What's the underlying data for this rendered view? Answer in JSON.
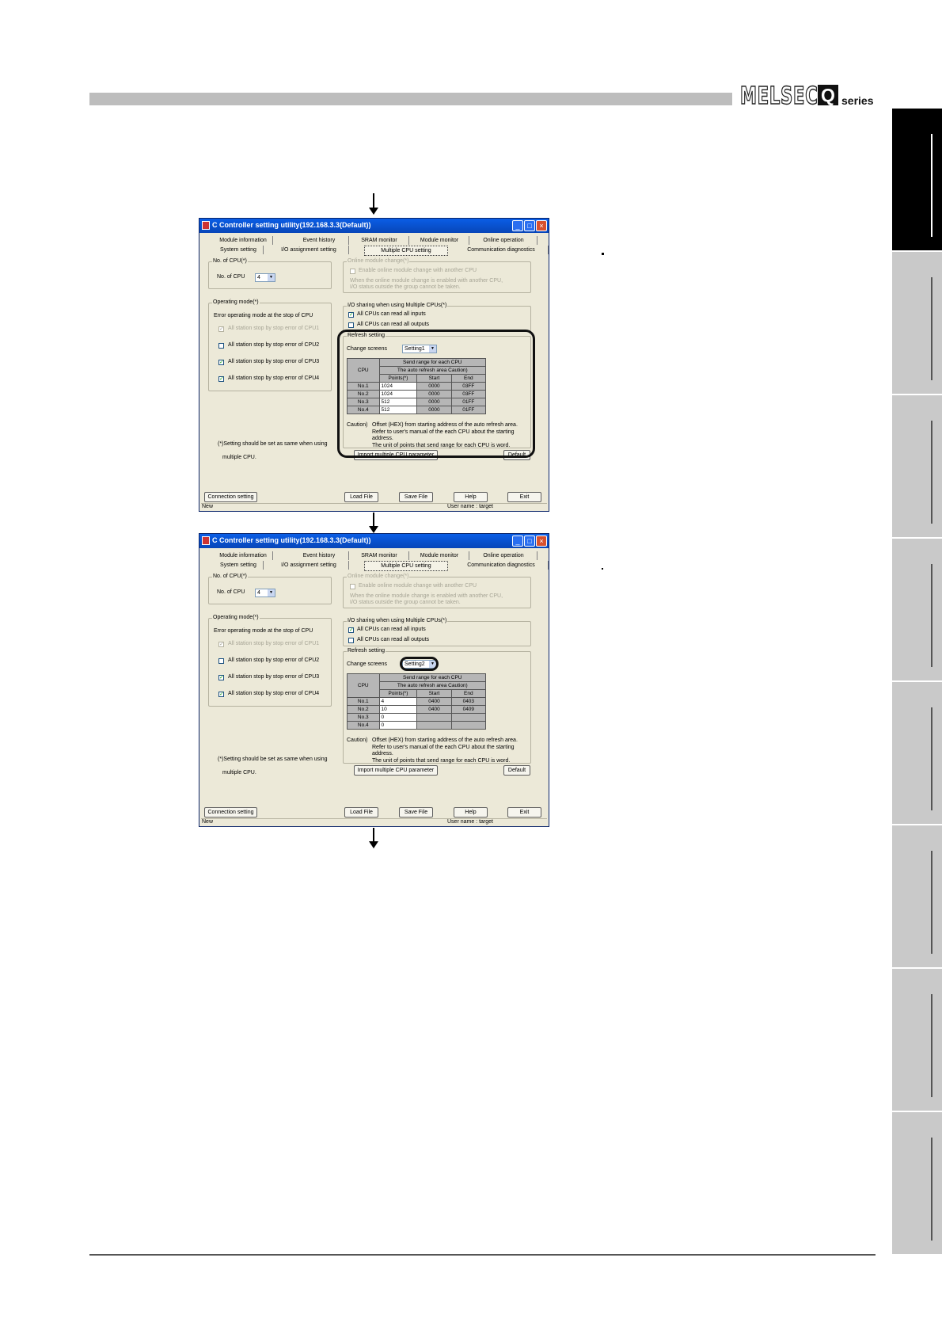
{
  "header": {
    "logo_brand": "MELSEC",
    "logo_q": "Q",
    "logo_series": "series"
  },
  "window_common": {
    "title": "C Controller setting utility(192.168.3.3(Default))",
    "tabs_row1": [
      "Module information",
      "Event history",
      "SRAM monitor",
      "Module monitor",
      "Online operation"
    ],
    "tabs_row2": [
      "System setting",
      "I/O assignment setting",
      "Multiple CPU setting",
      "Communication diagnostics"
    ],
    "no_cpu_group": "No. of CPU(*)",
    "no_cpu_label": "No. of CPU",
    "online_change_group": "Online module change(*)",
    "online_change_check": "Enable online module change with another CPU",
    "online_change_note1": "When the online module change is enabled with another CPU,",
    "online_change_note2": "I/O status outside the group cannot be taken.",
    "op_mode_group": "Operating mode(*)",
    "op_mode_subtitle": "Error operating mode at the stop of CPU",
    "op_mode_items": [
      "All station stop by stop error of CPU1",
      "All station stop by stop error of CPU2",
      "All station stop by stop error of CPU3",
      "All station stop by stop error of CPU4"
    ],
    "op_mode_checked": [
      true,
      false,
      true,
      true
    ],
    "io_group": "I/O sharing when using Multiple CPUs(*)",
    "io_items": [
      "All CPUs can read all inputs",
      "All CPUs can read all outputs"
    ],
    "io_checked": [
      true,
      false
    ],
    "refresh_group": "Refresh setting",
    "change_screens_label": "Change screens",
    "table_head_send": "Send range for each CPU",
    "table_head_auto": "The auto refresh area Caution)",
    "table_head_cpu": "CPU",
    "table_head_points": "Points(*)",
    "table_head_start": "Start",
    "table_head_end": "End",
    "caution_label": "Caution)",
    "caution_lines": [
      "Offset (HEX) from starting address of the auto refresh area.",
      "Refer to user's manual of the each CPU about the starting",
      "address.",
      "The unit of points that send range for each CPU is word."
    ],
    "note_line1": "(*)Setting should be set as same when using",
    "note_line2": "multiple CPU.",
    "import_button": "Import multiple CPU parameter",
    "default_button": "Default",
    "connection_button": "Connection setting",
    "load_button": "Load File",
    "save_button": "Save File",
    "help_button": "Help",
    "exit_button": "Exit",
    "status_left": "New",
    "status_right": "User name : target"
  },
  "window1": {
    "no_cpu_value": "4",
    "change_screens_value": "Setting1",
    "rows": [
      {
        "cpu": "No.1",
        "points": "1024",
        "start": "0000",
        "end": "03FF"
      },
      {
        "cpu": "No.2",
        "points": "1024",
        "start": "0000",
        "end": "03FF"
      },
      {
        "cpu": "No.3",
        "points": "512",
        "start": "0000",
        "end": "01FF"
      },
      {
        "cpu": "No.4",
        "points": "512",
        "start": "0000",
        "end": "01FF"
      }
    ]
  },
  "window2": {
    "no_cpu_value": "4",
    "change_screens_value": "Setting2",
    "rows": [
      {
        "cpu": "No.1",
        "points": "4",
        "start": "0400",
        "end": "0403"
      },
      {
        "cpu": "No.2",
        "points": "10",
        "start": "0400",
        "end": "0409"
      },
      {
        "cpu": "No.3",
        "points": "0",
        "start": "",
        "end": ""
      },
      {
        "cpu": "No.4",
        "points": "0",
        "start": "",
        "end": ""
      }
    ]
  }
}
